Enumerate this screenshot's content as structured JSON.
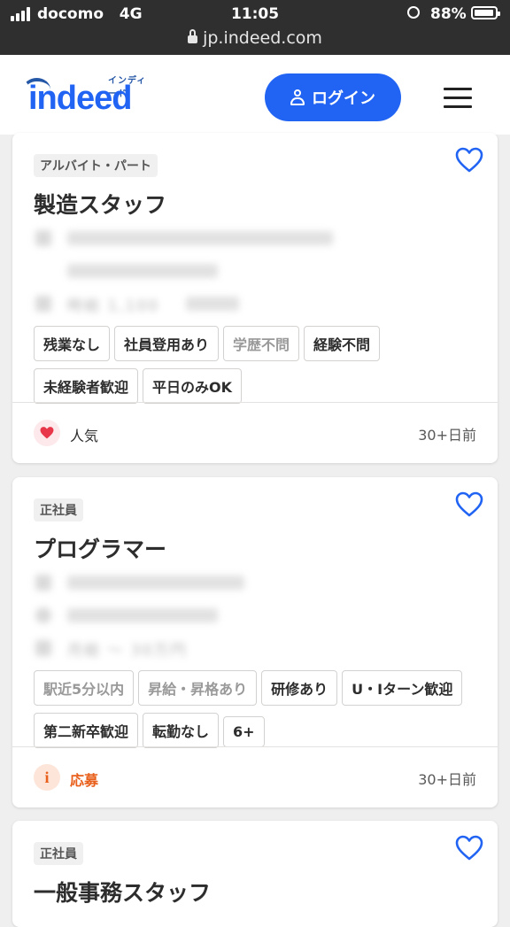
{
  "status_bar": {
    "carrier": "docomo",
    "network": "4G",
    "time": "11:05",
    "battery": "88%",
    "url": "jp.indeed.com"
  },
  "header": {
    "logo_text": "indeed",
    "logo_kana": "インディード",
    "login_label": "ログイン",
    "brand_color": "#2164f3"
  },
  "jobs": [
    {
      "type": "アルバイト・パート",
      "title": "製造スタッフ",
      "blurred_salary": "時給 1,100",
      "tags": [
        "残業なし",
        "社員登用あり",
        "学歴不問",
        "経験不問",
        "未経験者歓迎",
        "平日のみOK"
      ],
      "footer_label": "人気",
      "footer_icon": "heart-icon",
      "posted": "30+日前"
    },
    {
      "type": "正社員",
      "title": "プログラマー",
      "blurred_salary": "月給   〜 30万円",
      "tags": [
        "駅近5分以内",
        "昇給・昇格あり",
        "研修あり",
        "U・Iターン歓迎",
        "第二新卒歓迎",
        "転勤なし",
        "6+"
      ],
      "footer_label": "応募",
      "footer_icon": "info-icon",
      "posted": "30+日前"
    },
    {
      "type": "正社員",
      "title": "一般事務スタッフ"
    }
  ],
  "colors": {
    "accent": "#2164f3",
    "popular": "#e8374b",
    "apply": "#e8601c"
  }
}
